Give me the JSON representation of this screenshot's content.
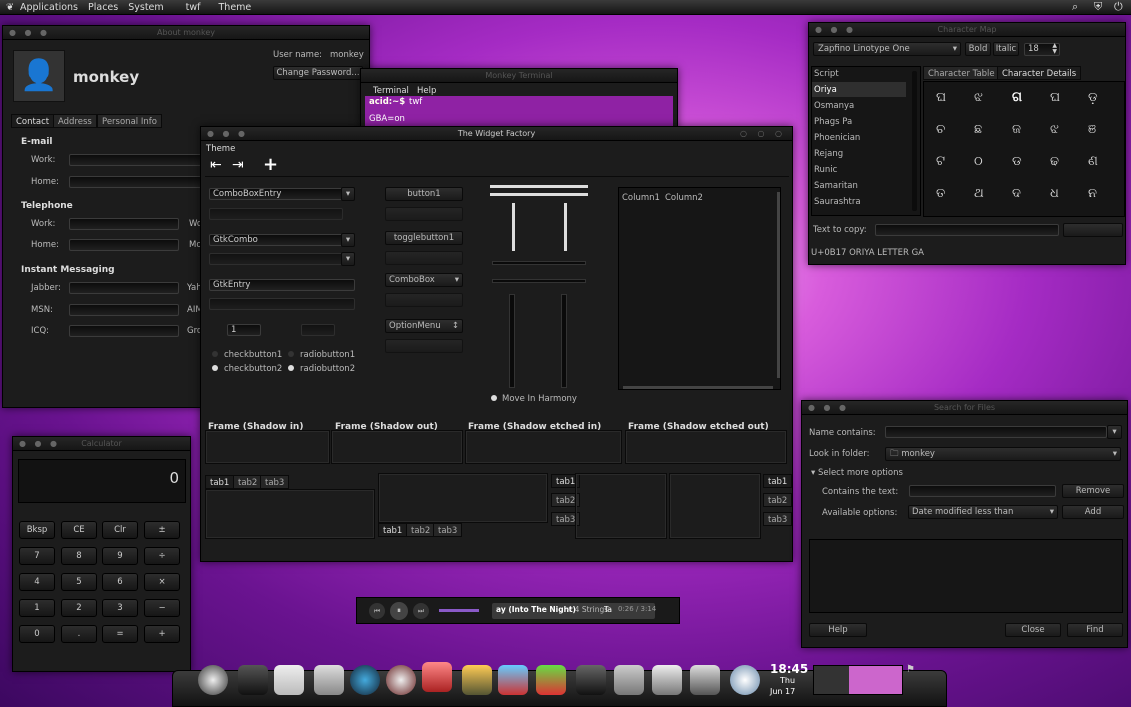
{
  "topbar": {
    "menu": [
      "Applications",
      "Places",
      "System",
      "twf",
      "Theme"
    ]
  },
  "about": {
    "title": "About monkey",
    "name": "monkey",
    "username_label": "User name:",
    "username": "monkey",
    "change_pw": "Change Password...",
    "tabs": [
      "Contact",
      "Address",
      "Personal Info"
    ],
    "email": "E-mail",
    "work": "Work:",
    "home": "Home:",
    "telephone": "Telephone",
    "wo": "Wo",
    "mo": "Mo",
    "im": "Instant Messaging",
    "jabber": "Jabber:",
    "msn": "MSN:",
    "icq": "ICQ:",
    "yah": "Yah",
    "aim": "AIM",
    "gro": "Gro"
  },
  "terminal": {
    "title": "Monkey Terminal",
    "menu": [
      "Terminal",
      "Help"
    ],
    "prompt": "acid:~$",
    "cmd": "twf",
    "line2": "GBA=on"
  },
  "charmap": {
    "title": "Character Map",
    "font": "Zapfino Linotype One",
    "bold": "Bold",
    "italic": "Italic",
    "size": "18",
    "script_hdr": "Script",
    "scripts": [
      "Oriya",
      "Osmanya",
      "Phags Pa",
      "Phoenician",
      "Rejang",
      "Runic",
      "Samaritan",
      "Saurashtra"
    ],
    "tabs": [
      "Character Table",
      "Character Details"
    ],
    "glyphs": [
      "ଘ",
      "ଝ",
      "ଗ",
      "ଘ",
      "ଡ଼",
      "ଚ",
      "ଛ",
      "ଜ",
      "ଝ",
      "ଞ",
      "ଟ",
      "ଠ",
      "ଡ",
      "ଢ",
      "ଣ",
      "ତ",
      "ଥ",
      "ଦ",
      "ଧ",
      "ନ"
    ],
    "copy_label": "Text to copy:",
    "status": "U+0B17 ORIYA LETTER GA"
  },
  "twf": {
    "title": "The Widget Factory",
    "menu": "Theme",
    "cbe": "ComboBoxEntry",
    "gtkcombo": "GtkCombo",
    "gtkentry": "GtkEntry",
    "spin": "1",
    "check1": "checkbutton1",
    "check2": "checkbutton2",
    "radio1": "radiobutton1",
    "radio2": "radiobutton2",
    "button1": "button1",
    "toggle1": "togglebutton1",
    "combobox": "ComboBox",
    "optionmenu": "OptionMenu",
    "harmony": "Move In Harmony",
    "col1": "Column1",
    "col2": "Column2",
    "f1": "Frame (Shadow in)",
    "f2": "Frame (Shadow out)",
    "f3": "Frame (Shadow etched in)",
    "f4": "Frame (Shadow etched out)",
    "tabs": [
      "tab1",
      "tab2",
      "tab3"
    ]
  },
  "calc": {
    "title": "Calculator",
    "display": "0",
    "rows": [
      [
        "Bksp",
        "CE",
        "Clr",
        "±"
      ],
      [
        "7",
        "8",
        "9",
        "÷"
      ],
      [
        "4",
        "5",
        "6",
        "×"
      ],
      [
        "1",
        "2",
        "3",
        "−"
      ],
      [
        "0",
        ".",
        "=",
        "+"
      ]
    ]
  },
  "search": {
    "title": "Search for Files",
    "name_label": "Name contains:",
    "folder_label": "Look in folder:",
    "folder": "monkey",
    "more": "Select more options",
    "contains_label": "Contains the text:",
    "remove": "Remove",
    "avail_label": "Available options:",
    "avail": "Date modified less than",
    "add": "Add",
    "help": "Help",
    "close": "Close",
    "find": "Find"
  },
  "player": {
    "track": "ay (Into The Night)",
    "artist": "+ 4 Strings",
    "extra": "Ta",
    "time": "0:26 / 3:14"
  },
  "clock": {
    "time": "18:45",
    "day": "Thu",
    "date": "Jun 17"
  }
}
